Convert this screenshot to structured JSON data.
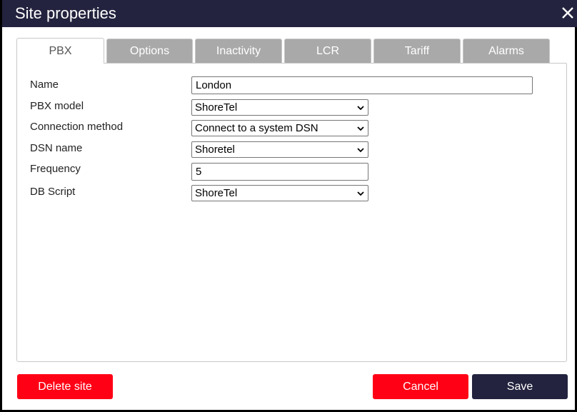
{
  "dialog": {
    "title": "Site properties",
    "close_icon": "close-icon"
  },
  "tabs": [
    {
      "label": "PBX",
      "active": true
    },
    {
      "label": "Options",
      "active": false
    },
    {
      "label": "Inactivity",
      "active": false
    },
    {
      "label": "LCR",
      "active": false
    },
    {
      "label": "Tariff",
      "active": false
    },
    {
      "label": "Alarms",
      "active": false
    }
  ],
  "form": {
    "name": {
      "label": "Name",
      "value": "London"
    },
    "pbx_model": {
      "label": "PBX model",
      "value": "ShoreTel"
    },
    "connection_method": {
      "label": "Connection method",
      "value": "Connect to a system DSN"
    },
    "dsn_name": {
      "label": "DSN name",
      "value": "Shoretel"
    },
    "frequency": {
      "label": "Frequency",
      "value": "5"
    },
    "db_script": {
      "label": "DB Script",
      "value": "ShoreTel"
    }
  },
  "buttons": {
    "delete_label": "Delete site",
    "cancel_label": "Cancel",
    "save_label": "Save"
  },
  "colors": {
    "titlebar": "#23233f",
    "danger": "#ff0015",
    "primary": "#23233f",
    "tab_inactive": "#a9a9a9"
  }
}
